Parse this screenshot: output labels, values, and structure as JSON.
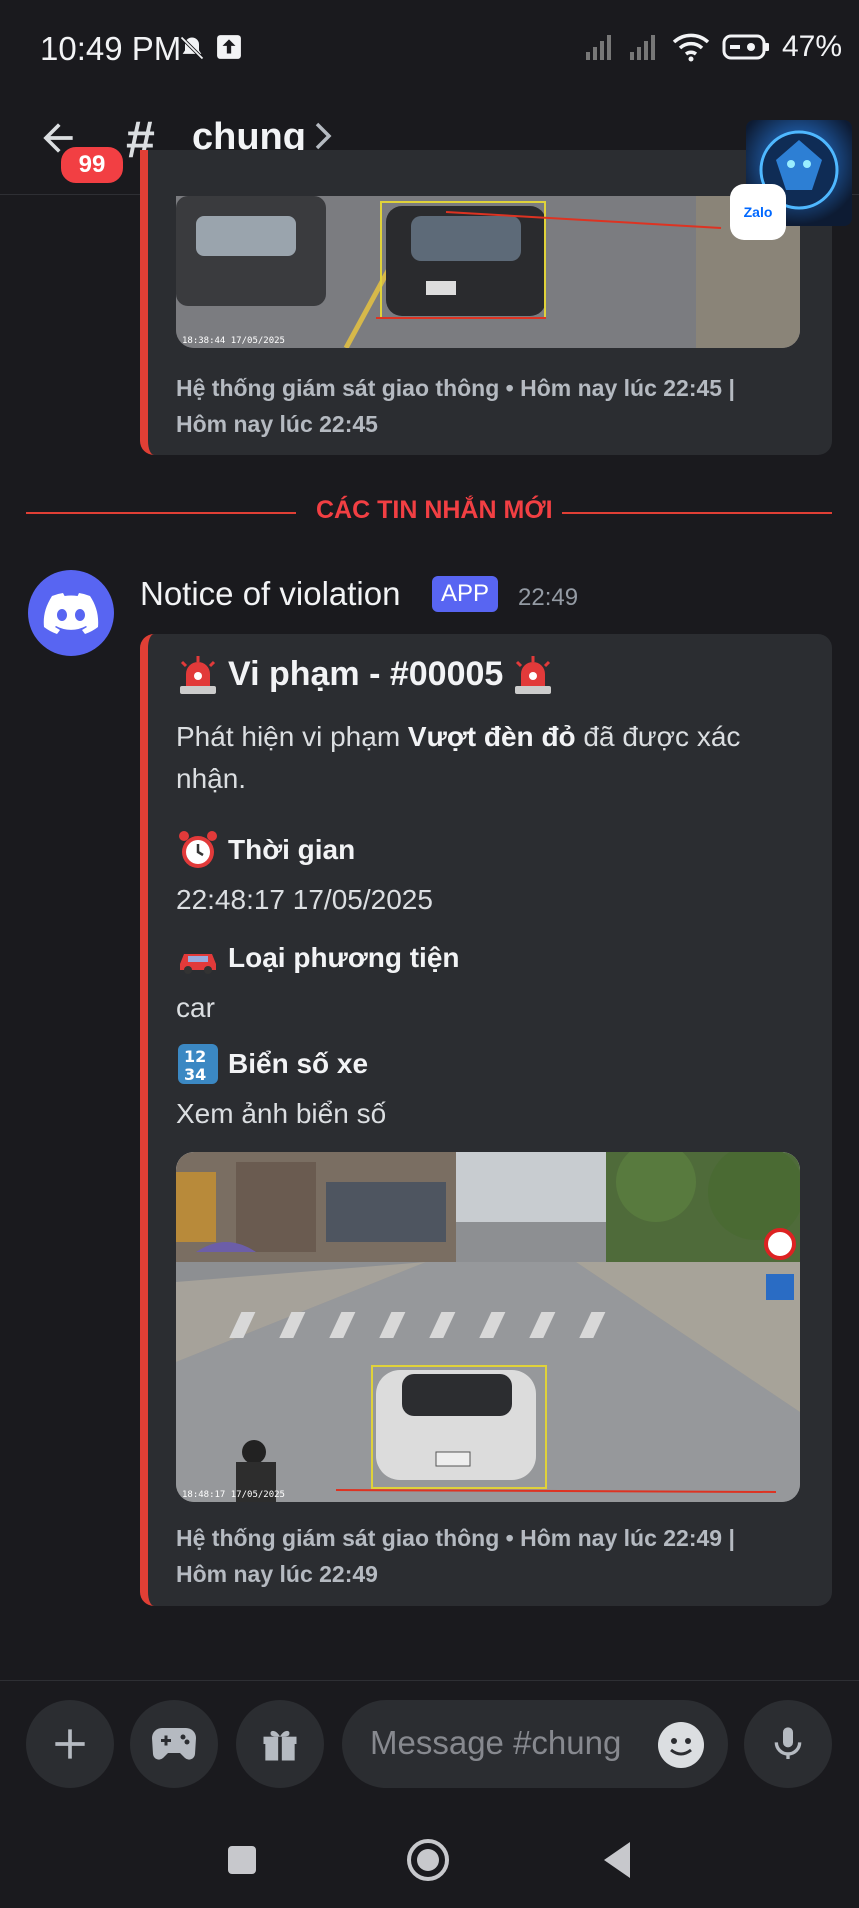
{
  "status_bar": {
    "time": "10:49 PM",
    "battery": "47%"
  },
  "header": {
    "unread_badge": "99",
    "channel_name": "chung"
  },
  "overlays": {
    "zalo_label": "Zalo"
  },
  "previous_embed": {
    "footer_line1": "Hệ thống giám sát giao thông • Hôm nay lúc 22:45 |",
    "footer_line2": "Hôm nay lúc 22:45",
    "image_stamp": "18:38:44 17/05/2025"
  },
  "divider": {
    "label": "CÁC TIN NHẮN MỚI"
  },
  "message": {
    "author": "Notice of violation",
    "tag": "APP",
    "time": "22:49",
    "embed": {
      "title": "Vi phạm - #00005",
      "desc_prefix": "Phát hiện vi phạm ",
      "desc_bold": "Vượt đèn đỏ",
      "desc_suffix": " đã được xác nhận.",
      "fields": [
        {
          "name": "Thời gian",
          "value": "22:48:17 17/05/2025",
          "icon": "alarm-clock-icon"
        },
        {
          "name": "Loại phương tiện",
          "value": "car",
          "icon": "car-icon"
        },
        {
          "name": "Biển số xe",
          "value": "Xem ảnh biển số",
          "icon": "numbers-icon"
        }
      ],
      "image_stamp": "18:48:17 17/05/2025",
      "footer_line1": "Hệ thống giám sát giao thông • Hôm nay lúc 22:49 |",
      "footer_line2": "Hôm nay lúc 22:49"
    }
  },
  "composer": {
    "placeholder": "Message #chung"
  }
}
